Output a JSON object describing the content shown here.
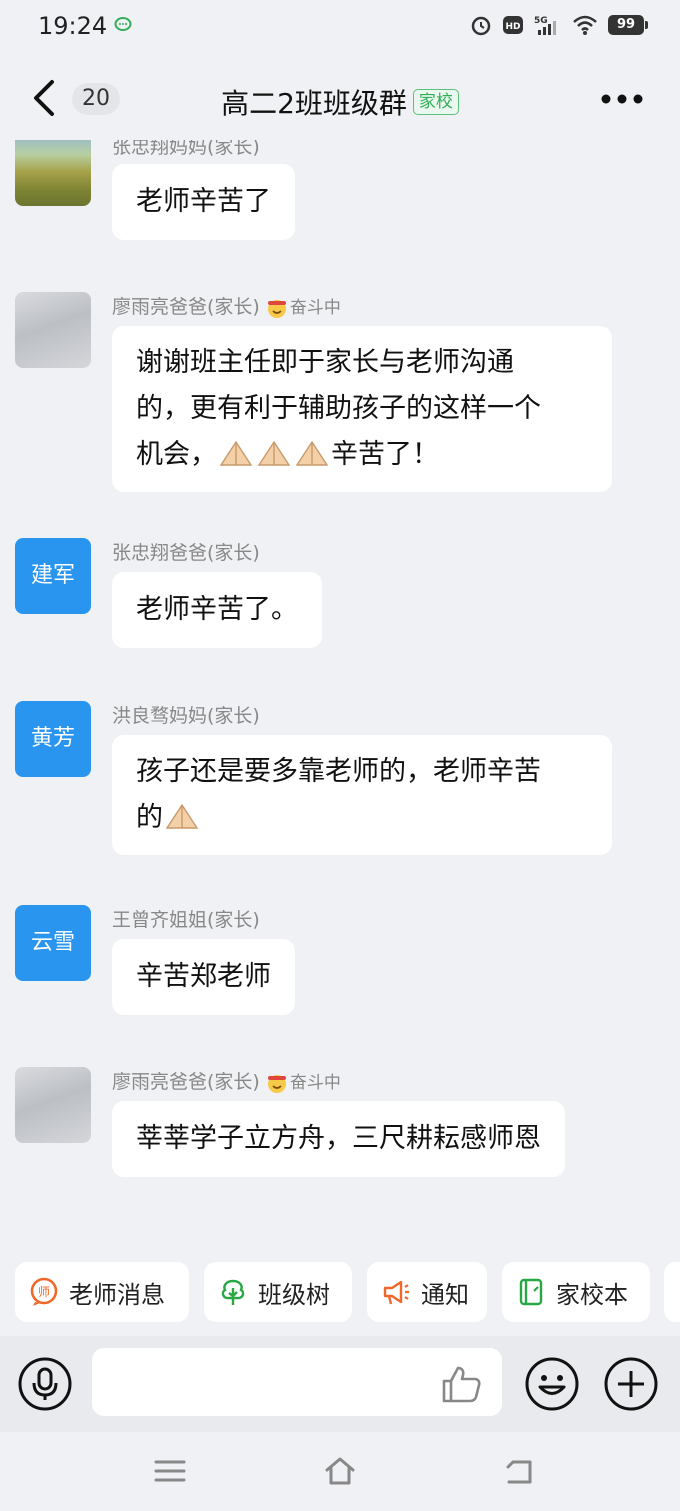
{
  "status_bar": {
    "time": "19:24",
    "battery": "99"
  },
  "header": {
    "unread_count": "20",
    "title": "高二2班班级群",
    "tag": "家校"
  },
  "messages": [
    {
      "sender": "张忠翔妈妈(家长)",
      "text": "老师辛苦了"
    },
    {
      "sender": "廖雨亮爸爸(家长)",
      "status": "奋斗中",
      "text_parts": [
        "谢谢班主任即于家长与老师沟通",
        "的，更有利于辅助孩子的这样一个",
        "机会，",
        "辛苦了！"
      ]
    },
    {
      "sender": "张忠翔爸爸(家长)",
      "avatar_text": "建军",
      "text": "老师辛苦了。"
    },
    {
      "sender": "洪良骛妈妈(家长)",
      "avatar_text": "黄芳",
      "text_parts": [
        "孩子还是要多靠老师的，老师辛苦",
        "的"
      ]
    },
    {
      "sender": "王曾齐姐姐(家长)",
      "avatar_text": "云雪",
      "text": "辛苦郑老师"
    },
    {
      "sender": "廖雨亮爸爸(家长)",
      "status": "奋斗中",
      "text": "莘莘学子立方舟，三尺耕耘感师恩"
    }
  ],
  "quick_actions": [
    {
      "label": "老师消息",
      "icon": "teacher-badge-icon"
    },
    {
      "label": "班级树",
      "icon": "tree-icon"
    },
    {
      "label": "通知",
      "icon": "megaphone-icon"
    },
    {
      "label": "家校本",
      "icon": "notebook-icon"
    }
  ],
  "input": {
    "placeholder": ""
  },
  "colors": {
    "accent_blue": "#2a95ef",
    "tag_green": "#2fae57",
    "quick_orange": "#f0682b",
    "quick_green": "#2aa745"
  }
}
